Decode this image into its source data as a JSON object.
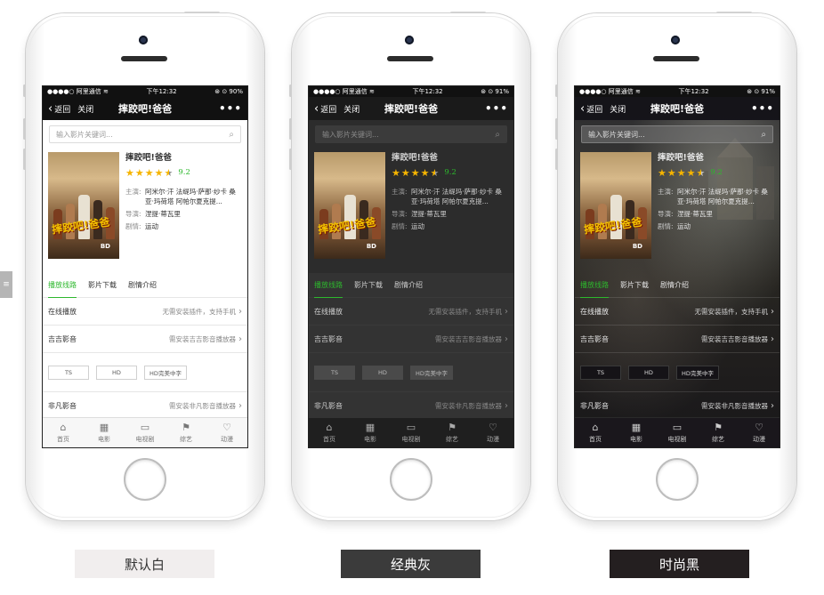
{
  "status": {
    "carrier": "●●●●○ 阿里通信 ≋",
    "time": "下午12:32",
    "battery_white": "⊛ ⊙ 90%",
    "battery_gray": "⊛ ⊙ 91%",
    "battery_black": "⊛ ⊙ 91%"
  },
  "nav": {
    "back": "返回",
    "close": "关闭",
    "title": "摔跤吧!爸爸",
    "more": "•••"
  },
  "search": {
    "placeholder": "输入影片关键词..."
  },
  "movie": {
    "title": "摔跤吧!爸爸",
    "rating": 9.2,
    "rating_text": "9.2",
    "stars_filled": 4.5,
    "cast_label": "主演:",
    "cast": "阿米尔·汗 法缇玛·萨那·纱卡 桑亚·玛荷塔 阿帕尔夏克提...",
    "director_label": "导演:",
    "director": "涅提·蒂瓦里",
    "genre_label": "剧情:",
    "genre": "运动",
    "poster_title": "摔跤吧!爸爸",
    "poster_badge": "BD"
  },
  "tabs": [
    "播放线路",
    "影片下载",
    "剧情介绍"
  ],
  "lines": [
    {
      "name": "在线播放",
      "note": "无需安装插件，支持手机"
    },
    {
      "name": "吉吉影音",
      "note": "需安装吉吉影音播放器"
    },
    {
      "name": "非凡影音",
      "note": "需安装非凡影音播放器"
    }
  ],
  "chips": [
    "TS",
    "HD",
    "HD完美中字"
  ],
  "tabbar": [
    {
      "label": "首页",
      "icon": "home-icon"
    },
    {
      "label": "电影",
      "icon": "film-icon"
    },
    {
      "label": "电视剧",
      "icon": "tv-icon"
    },
    {
      "label": "综艺",
      "icon": "flag-icon"
    },
    {
      "label": "动漫",
      "icon": "heart-shield-icon"
    }
  ],
  "captions": [
    "默认白",
    "经典灰",
    "时尚黑"
  ],
  "side_tab": "≡",
  "colors": {
    "accent": "#2db82d",
    "star": "#f5b400",
    "gray_theme": "#2c2c2c",
    "black_theme": "#1e1a22"
  }
}
